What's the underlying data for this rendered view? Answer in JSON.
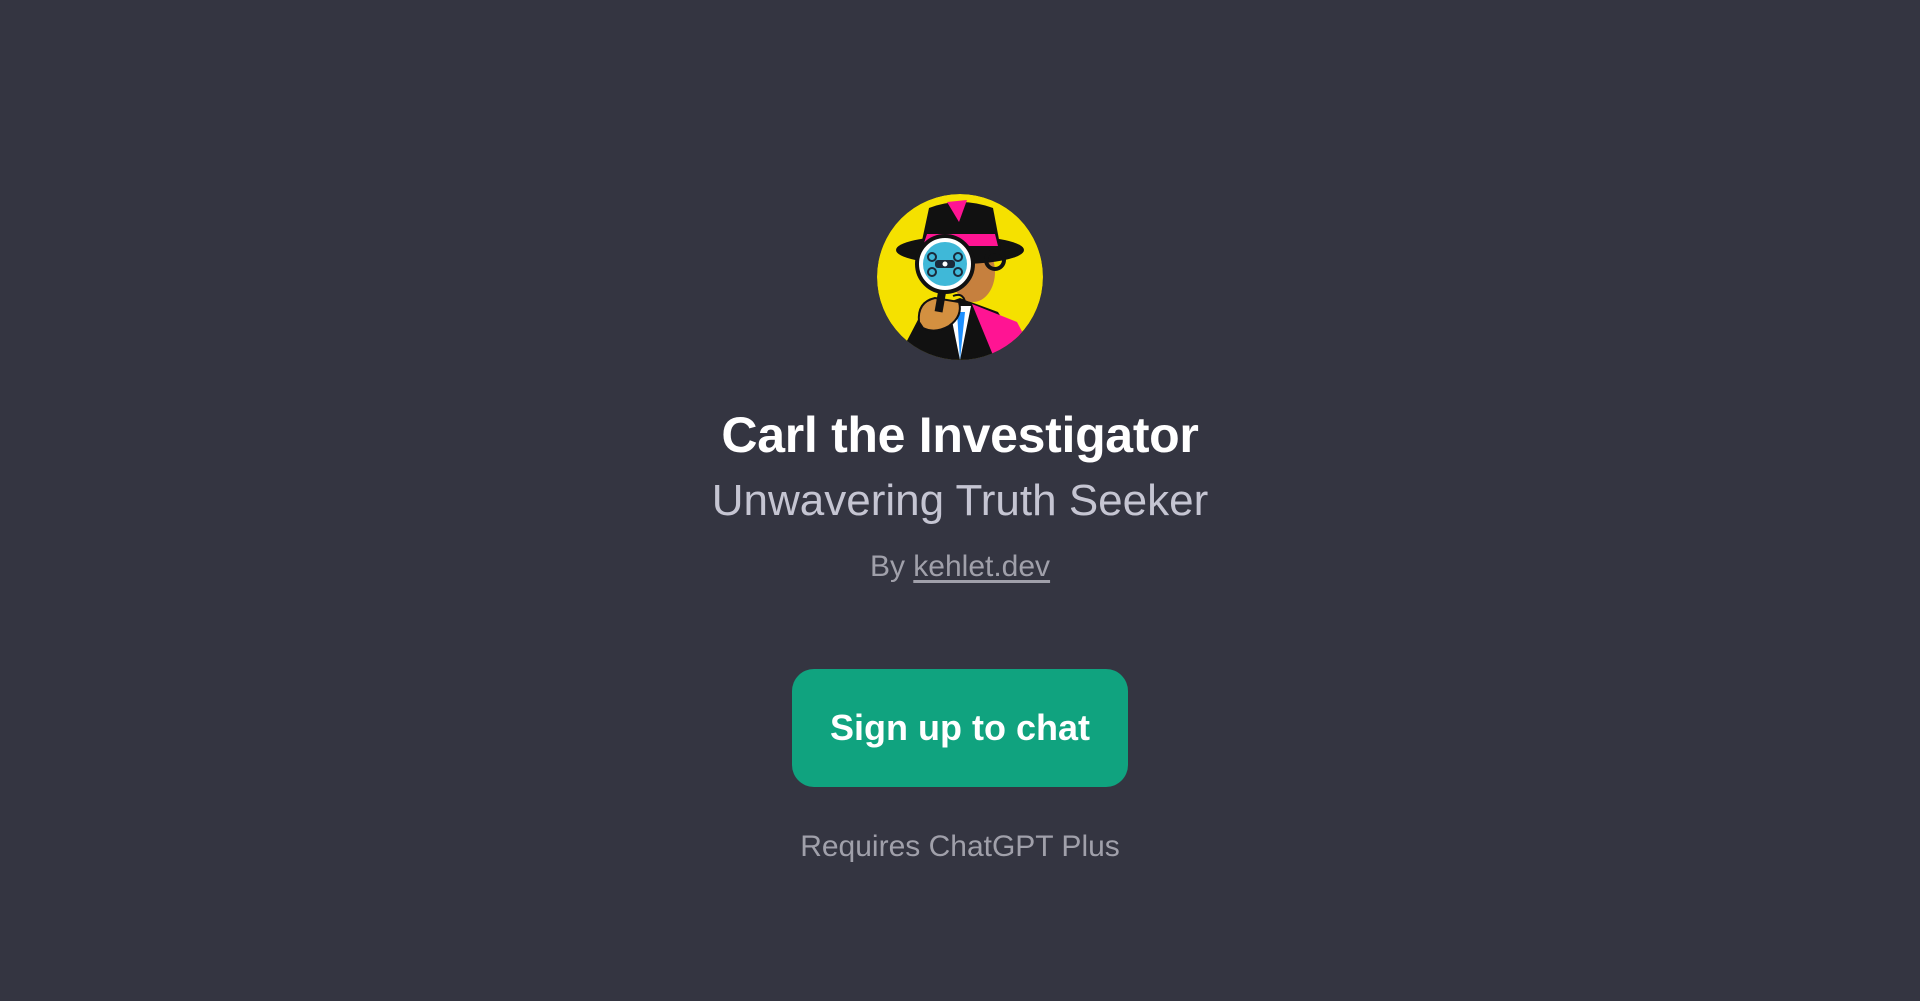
{
  "gpt": {
    "avatar_icon": "detective-avatar-icon",
    "name": "Carl the Investigator",
    "description": "Unwavering Truth Seeker",
    "by_prefix": "By",
    "author": "kehlet.dev"
  },
  "actions": {
    "signup_label": "Sign up to chat",
    "requirement": "Requires ChatGPT Plus"
  },
  "colors": {
    "background": "#343541",
    "accent": "#10a37f",
    "avatar_bg": "#f5e100",
    "hat_pink": "#ff1493"
  }
}
